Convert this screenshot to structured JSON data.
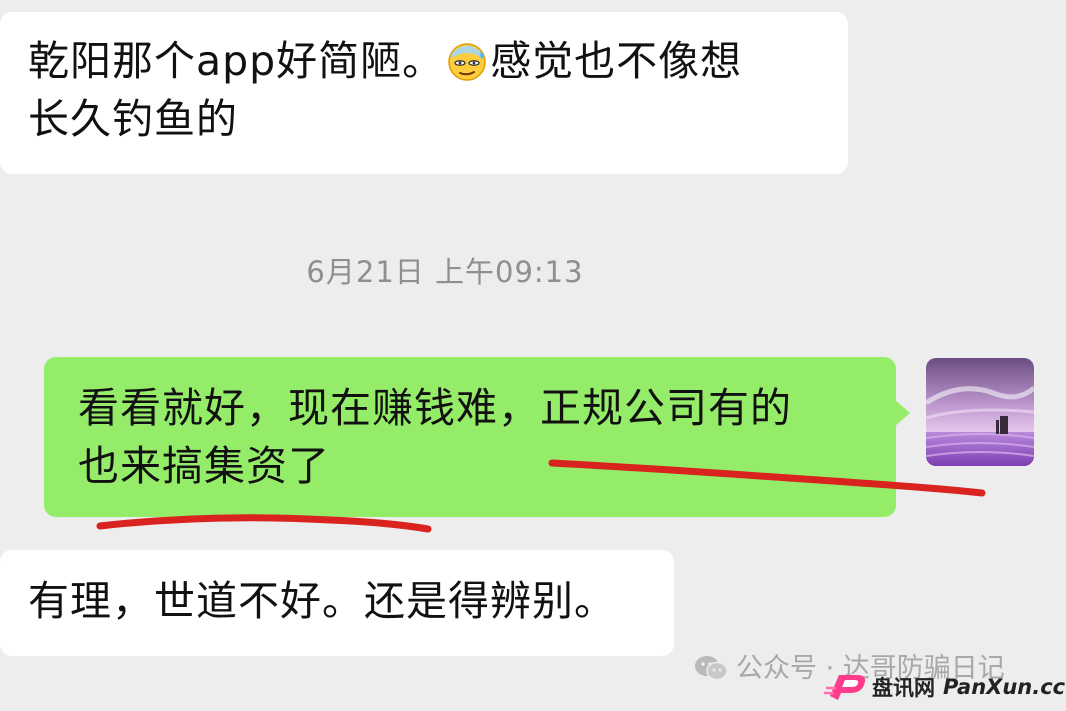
{
  "messages": [
    {
      "direction": "incoming",
      "text_before_emoji": "乾阳那个app好简陋。",
      "emoji": "sweat-smile-emoji",
      "text_after_emoji": "感觉也不像想",
      "line2": "长久钓鱼的"
    },
    {
      "direction": "outgoing",
      "line1": "看看就好，现在赚钱难，正规公司有的",
      "line2": "也来搞集资了"
    },
    {
      "direction": "incoming",
      "text": "有理，世道不好。还是得辨别。"
    }
  ],
  "timestamp": "6月21日 上午09:13",
  "colors": {
    "background": "#ededed",
    "incoming_bubble": "#ffffff",
    "outgoing_bubble": "#95ec69",
    "annotation_line": "#d9231f",
    "timestamp_text": "#8f8f8f"
  },
  "watermark": {
    "icon": "wechat-icon",
    "text": "公众号 · 达哥防骗日记"
  },
  "brand": {
    "logo": "panxun-logo-icon",
    "name": "盘讯网",
    "domain": "PanXun.cc"
  }
}
